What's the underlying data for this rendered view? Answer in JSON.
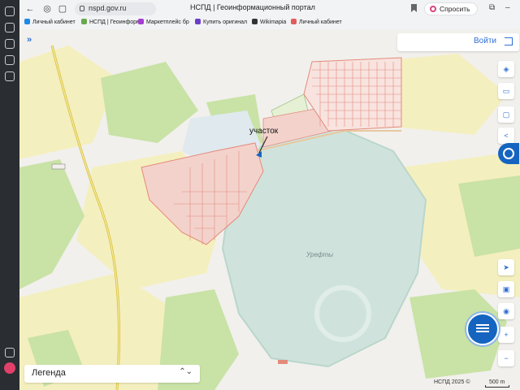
{
  "browser": {
    "url": "nspd.gov.ru",
    "title": "НСПД | Геоинформационный портал",
    "ask_button": "Спросить",
    "bookmarks": [
      {
        "label": "Личный кабинет",
        "color": "#1e88e5"
      },
      {
        "label": "НСПД | Геоинформ",
        "color": "#6aa84f"
      },
      {
        "label": "Маркетплейс бр",
        "color": "#a33ed1"
      },
      {
        "label": "Купить оригинал",
        "color": "#6a3ec9"
      },
      {
        "label": "Wikimapia",
        "color": "#333333"
      },
      {
        "label": "Личный кабинет",
        "color": "#e35d5d"
      }
    ]
  },
  "map": {
    "login_label": "Войти",
    "legend_label": "Легенда",
    "lake_label": "Урефты",
    "plot_label": "участок",
    "copyright": "НСПД 2025 ©",
    "scale_label": "500 m",
    "colors": {
      "land": "#f1f0ec",
      "forest": "#c9e2a6",
      "field": "#f4efbe",
      "water": "#cfe3dc",
      "parcel": "#f3d2cc",
      "parcel_stroke": "#e48a7a",
      "road": "#d9c23a"
    },
    "tools": [
      "layers-icon",
      "ruler-icon",
      "share-icon",
      "locate-icon",
      "print-icon",
      "search-location-icon",
      "zoom-in-icon",
      "zoom-out-icon"
    ]
  }
}
